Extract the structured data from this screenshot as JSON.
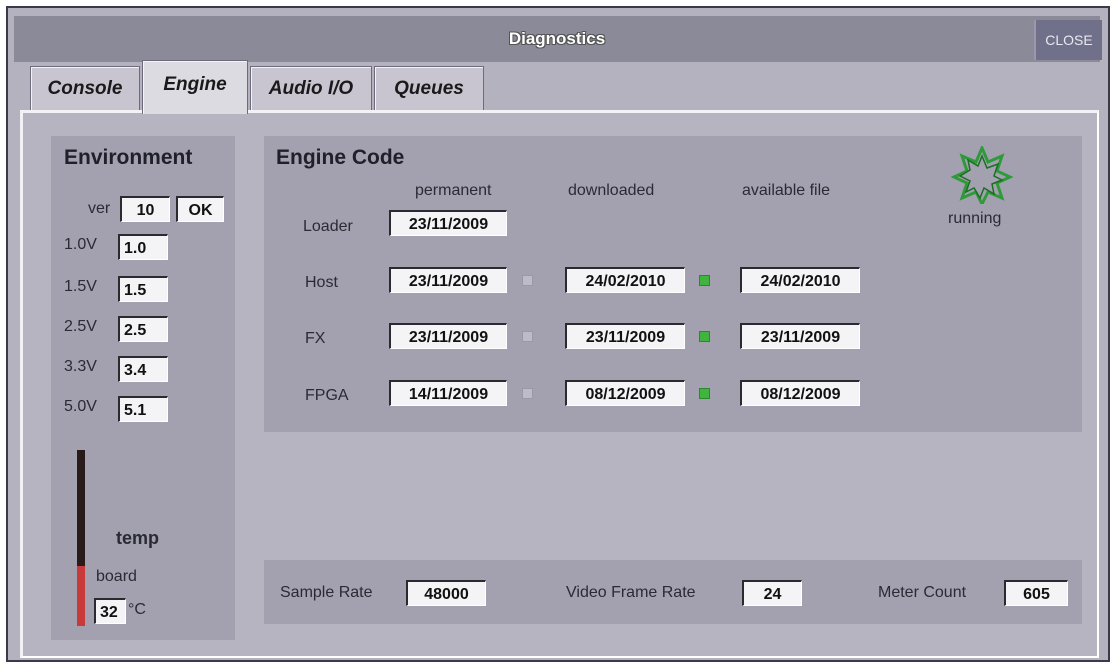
{
  "window": {
    "title": "Diagnostics",
    "close_label": "CLOSE"
  },
  "tabs": [
    "Console",
    "Engine",
    "Audio I/O",
    "Queues"
  ],
  "active_tab": "Engine",
  "environment": {
    "heading": "Environment",
    "ver_label": "ver",
    "ver_value": "10",
    "ver_status": "OK",
    "voltages": [
      {
        "label": "1.0V",
        "value": "1.0"
      },
      {
        "label": "1.5V",
        "value": "1.5"
      },
      {
        "label": "2.5V",
        "value": "2.5"
      },
      {
        "label": "3.3V",
        "value": "3.4"
      },
      {
        "label": "5.0V",
        "value": "5.1"
      }
    ],
    "temp_label": "temp",
    "board_label": "board",
    "board_temp": "32",
    "temp_unit": "°C"
  },
  "engine_code": {
    "heading": "Engine Code",
    "col_permanent": "permanent",
    "col_downloaded": "downloaded",
    "col_available": "available file",
    "status": "running",
    "rows": [
      {
        "label": "Loader",
        "permanent": "23/11/2009"
      },
      {
        "label": "Host",
        "permanent": "23/11/2009",
        "downloaded": "24/02/2010",
        "available": "24/02/2010"
      },
      {
        "label": "FX",
        "permanent": "23/11/2009",
        "downloaded": "23/11/2009",
        "available": "23/11/2009"
      },
      {
        "label": "FPGA",
        "permanent": "14/11/2009",
        "downloaded": "08/12/2009",
        "available": "08/12/2009"
      }
    ]
  },
  "footer": {
    "sample_rate_label": "Sample Rate",
    "sample_rate": "48000",
    "video_frame_rate_label": "Video Frame Rate",
    "video_frame_rate": "24",
    "meter_count_label": "Meter Count",
    "meter_count": "605"
  },
  "colors": {
    "indicator_on": "#3fb53f",
    "temp_bar": "#c83a3a",
    "status_icon": "#2f9a3a"
  }
}
